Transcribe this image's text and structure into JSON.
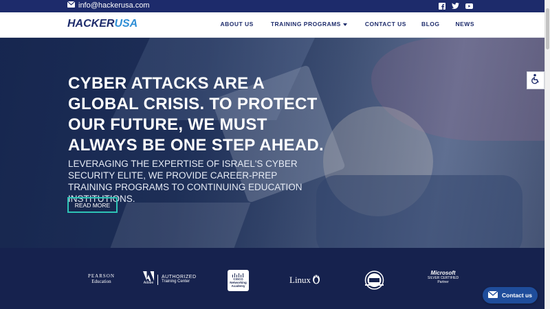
{
  "topbar": {
    "email": "info@hackerusa.com",
    "social_icons": [
      "facebook-icon",
      "twitter-icon",
      "youtube-icon"
    ]
  },
  "nav": {
    "logo_prefix": "HACKER",
    "logo_suffix": "USA",
    "items": [
      {
        "label": "ABOUT US"
      },
      {
        "label": "TRAINING PROGRAMS"
      },
      {
        "label": "CONTACT US"
      },
      {
        "label": "BLOG"
      },
      {
        "label": "NEWS"
      }
    ]
  },
  "hero": {
    "headline": "CYBER ATTACKS ARE A GLOBAL CRISIS. TO PROTECT OUR FUTURE, WE MUST ALWAYS BE ONE STEP AHEAD.",
    "subtext": "LEVERAGING THE EXPERTISE OF ISRAEL'S CYBER SECURITY ELITE, WE PROVIDE CAREER-PREP TRAINING PROGRAMS TO CONTINUING EDUCATION INSTITUTIONS.",
    "button": "READ MORE"
  },
  "partners": {
    "pearson": {
      "line1": "PEARSON",
      "line2": "Education"
    },
    "adobe": {
      "mark": "Adobe",
      "line1": "AUTHORIZED",
      "line2": "Training Center"
    },
    "cisco": {
      "line1": "CISCO",
      "line2": "Networking",
      "line3": "Academy"
    },
    "linux": {
      "name": "Linux"
    },
    "microsoft": {
      "line1": "Microsoft",
      "line2": "SILVER CERTIFIED",
      "line3": "Partner"
    }
  },
  "contact_widget": {
    "label": "Contact us"
  },
  "colors": {
    "topbar": "#1d2b6b",
    "accent": "#2ec4b6",
    "partners_bg": "#16224e",
    "contact_btn": "#1f4d9b"
  }
}
